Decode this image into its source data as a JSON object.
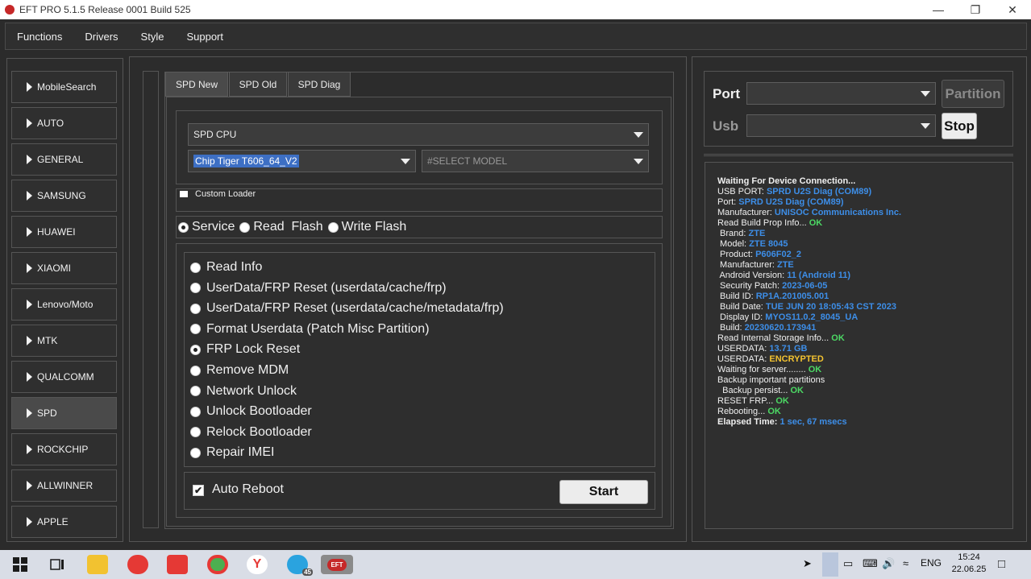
{
  "window": {
    "title": "EFT PRO 5.1.5 Release 0001 Build 525",
    "minimize_icon": "—",
    "restore_icon": "❐",
    "close_icon": "✕"
  },
  "menu": [
    "Functions",
    "Drivers",
    "Style",
    "Support"
  ],
  "sidebar": {
    "items": [
      "MobileSearch",
      "AUTO",
      "GENERAL",
      "SAMSUNG",
      "HUAWEI",
      "XIAOMI",
      "Lenovo/Moto",
      "MTK",
      "QUALCOMM",
      "SPD",
      "ROCKCHIP",
      "ALLWINNER",
      "APPLE"
    ],
    "active": "SPD"
  },
  "tabs": [
    "SPD New",
    "SPD Old",
    "SPD Diag"
  ],
  "cpu_select": {
    "value": "SPD CPU"
  },
  "chip_select": {
    "value": "Chip Tiger T606_64_V2"
  },
  "model_select": {
    "value": "#SELECT MODEL"
  },
  "custom_loader": {
    "label": "Custom Loader"
  },
  "mode": {
    "options": [
      "Service",
      "Read  Flash",
      "Write Flash"
    ],
    "selected": "Service"
  },
  "operations": {
    "options": [
      "Read Info",
      "UserData/FRP Reset (userdata/cache/frp)",
      "UserData/FRP Reset (userdata/cache/metadata/frp)",
      "Format Userdata (Patch Misc Partition)",
      "FRP Lock Reset",
      "Remove MDM",
      "Network Unlock",
      "Unlock Bootloader",
      "Relock Bootloader",
      "Repair IMEI"
    ],
    "selected": "FRP Lock Reset"
  },
  "auto_reboot": {
    "label": "Auto Reboot",
    "checked": true,
    "check_glyph": "✔"
  },
  "start_button": "Start",
  "port_panel": {
    "port_label": "Port",
    "usb_label": "Usb",
    "partition_button": "Partition",
    "stop_button": "Stop"
  },
  "log": [
    {
      "k": "Waiting For Device Connection...",
      "v": "",
      "kb": true
    },
    {
      "k": "USB PORT: ",
      "v": "SPRD U2S Diag (COM89)"
    },
    {
      "k": "Port: ",
      "v": "SPRD U2S Diag (COM89)"
    },
    {
      "k": "Manufacturer: ",
      "v": "UNISOC Communications Inc."
    },
    {
      "k": "Read Build Prop Info... ",
      "v": "OK",
      "t": "ok"
    },
    {
      "k": " Brand: ",
      "v": "ZTE"
    },
    {
      "k": " Model: ",
      "v": "ZTE 8045"
    },
    {
      "k": " Product: ",
      "v": "P606F02_2"
    },
    {
      "k": " Manufacturer: ",
      "v": "ZTE"
    },
    {
      "k": " Android Version: ",
      "v": "11 (Android 11)"
    },
    {
      "k": " Security Patch: ",
      "v": "2023-06-05"
    },
    {
      "k": " Build ID: ",
      "v": "RP1A.201005.001"
    },
    {
      "k": " Build Date: ",
      "v": "TUE JUN 20 18:05:43 CST 2023"
    },
    {
      "k": " Display ID: ",
      "v": "MYOS11.0.2_8045_UA"
    },
    {
      "k": " Build: ",
      "v": "20230620.173941"
    },
    {
      "k": "Read Internal Storage Info... ",
      "v": "OK",
      "t": "ok"
    },
    {
      "k": "USERDATA: ",
      "v": "13.71 GB"
    },
    {
      "k": "USERDATA: ",
      "v": "ENCRYPTED",
      "t": "warn"
    },
    {
      "k": "Waiting for server........ ",
      "v": "OK",
      "t": "ok"
    },
    {
      "k": "Backup important partitions",
      "v": ""
    },
    {
      "k": "  Backup persist... ",
      "v": "OK",
      "t": "ok"
    },
    {
      "k": "RESET FRP... ",
      "v": "OK",
      "t": "ok"
    },
    {
      "k": "Rebooting... ",
      "v": "OK",
      "t": "ok"
    },
    {
      "k": "Elapsed Time: ",
      "v": "1 sec, 67 msecs",
      "kb": true
    }
  ],
  "taskbar": {
    "telegram_badge": "45",
    "eft_label": "EFT",
    "language": "ENG",
    "time": "15:24",
    "date": "22.06.25"
  }
}
